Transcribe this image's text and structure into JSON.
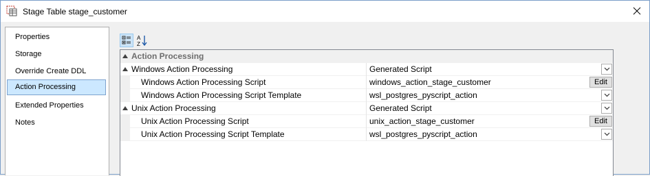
{
  "window": {
    "title": "Stage Table stage_customer"
  },
  "nav": {
    "items": [
      {
        "label": "Properties",
        "selected": false
      },
      {
        "label": "Storage",
        "selected": false
      },
      {
        "label": "Override Create DDL",
        "selected": false
      },
      {
        "label": "Action Processing",
        "selected": true
      },
      {
        "label": "Extended Properties",
        "selected": false
      },
      {
        "label": "Notes",
        "selected": false
      }
    ]
  },
  "toolbar": {
    "categorized_icon": "categorized-view-icon",
    "alphabetical_icon": "alphabetical-sort-icon",
    "alphabetical_glyph": "A Z"
  },
  "grid": {
    "category": "Action Processing",
    "rows": [
      {
        "name": "Windows Action Processing",
        "value": "Generated Script",
        "control": "dropdown"
      },
      {
        "name": "Windows Action Processing Script",
        "value": "windows_action_stage_customer",
        "control": "edit"
      },
      {
        "name": "Windows Action Processing Script Template",
        "value": "wsl_postgres_pyscript_action",
        "control": "dropdown"
      },
      {
        "name": "Unix Action Processing",
        "value": "Generated Script",
        "control": "dropdown"
      },
      {
        "name": "Unix Action Processing Script",
        "value": "unix_action_stage_customer",
        "control": "edit"
      },
      {
        "name": "Unix Action Processing Script Template",
        "value": "wsl_postgres_pyscript_action",
        "control": "dropdown"
      }
    ],
    "edit_label": "Edit"
  }
}
